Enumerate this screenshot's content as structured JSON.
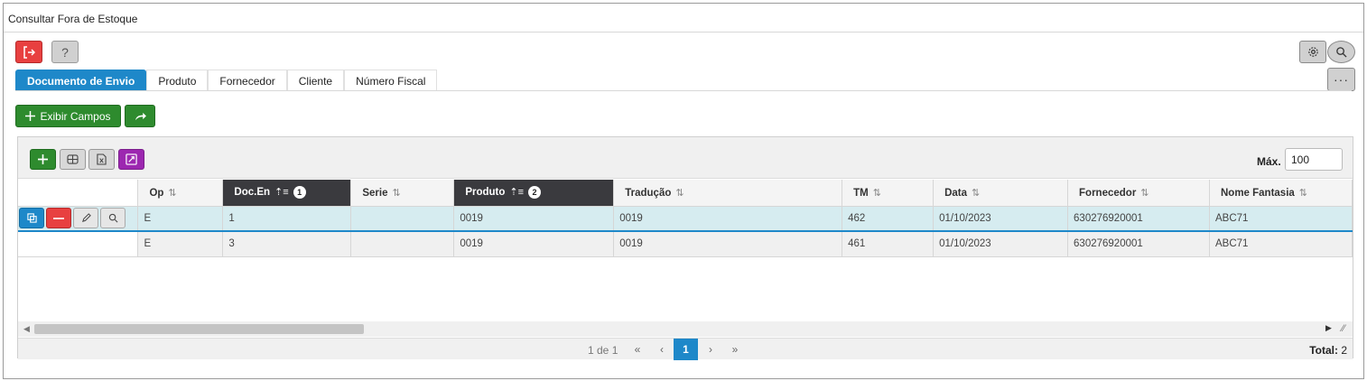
{
  "window": {
    "title": "Consultar Fora de Estoque"
  },
  "icons": {
    "exit": "logout-icon",
    "help": "question-icon",
    "settings": "gear-icon",
    "search": "search-icon",
    "more": "ellipsis-icon",
    "add": "plus-icon",
    "share": "share-arrow-icon",
    "grid": "grid-icon",
    "excel": "excel-icon",
    "expand": "expand-icon",
    "copy": "copy-icon",
    "delete": "minus-icon",
    "edit": "pencil-icon",
    "view": "magnifier-icon"
  },
  "colors": {
    "primary": "#1e88c9",
    "success": "#2e8b2e",
    "danger": "#e84040",
    "purple": "#9c27b0",
    "header_sorted": "#3a3a3e"
  },
  "header": {
    "help_label": "?",
    "more_label": "···"
  },
  "tabs": [
    {
      "label": "Documento de Envio",
      "active": true
    },
    {
      "label": "Produto"
    },
    {
      "label": "Fornecedor"
    },
    {
      "label": "Cliente"
    },
    {
      "label": "Número Fiscal"
    }
  ],
  "toolbar": {
    "exibir_label": "Exibir Campos"
  },
  "grid": {
    "max_label": "Máx.",
    "max_value": "100",
    "columns": [
      {
        "label": "Op",
        "sort": "none"
      },
      {
        "label": "Doc.En",
        "sort": "asc",
        "sort_order": "1"
      },
      {
        "label": "Serie",
        "sort": "none"
      },
      {
        "label": "Produto",
        "sort": "asc",
        "sort_order": "2"
      },
      {
        "label": "Tradução",
        "sort": "none"
      },
      {
        "label": "TM",
        "sort": "none"
      },
      {
        "label": "Data",
        "sort": "none"
      },
      {
        "label": "Fornecedor",
        "sort": "none"
      },
      {
        "label": "Nome Fantasia",
        "sort": "none"
      }
    ],
    "rows": [
      {
        "selected": true,
        "cells": [
          "E",
          "1",
          "",
          "0019",
          "0019",
          "462",
          "01/10/2023",
          "630276920001",
          "ABC71"
        ]
      },
      {
        "selected": false,
        "cells": [
          "E",
          "3",
          "",
          "0019",
          "0019",
          "461",
          "01/10/2023",
          "630276920001",
          "ABC71"
        ]
      }
    ]
  },
  "pagination": {
    "page_info": "1 de 1",
    "first": "«",
    "prev": "‹",
    "current": "1",
    "next": "›",
    "last": "»",
    "total_label": "Total:",
    "total_value": "2"
  }
}
